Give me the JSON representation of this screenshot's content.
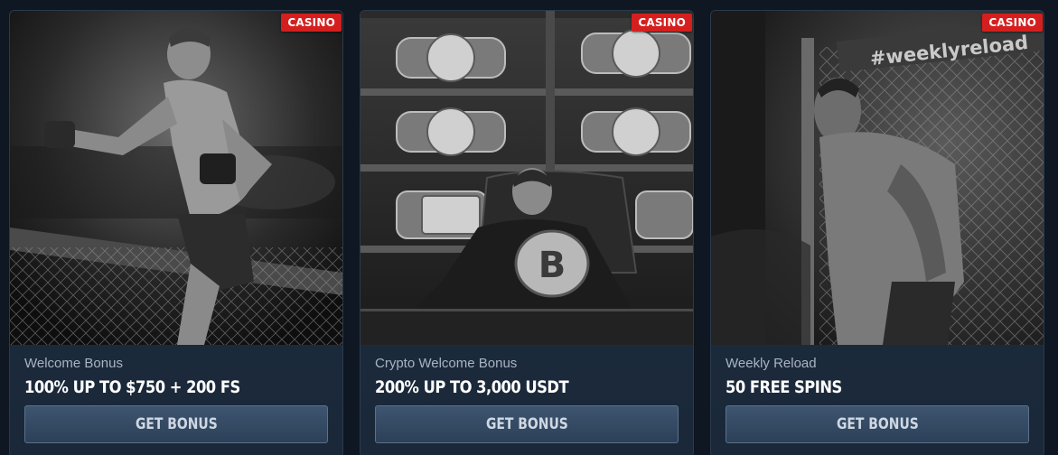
{
  "colors": {
    "page_bg": "#0e1722",
    "badge": "#d51f1f",
    "button": "#34495f",
    "offer_text": "#ffffff",
    "subtitle_text": "#a8b4c2"
  },
  "cards": [
    {
      "badge": "CASINO",
      "subtitle": "Welcome Bonus",
      "offer": "100% UP TO $750 + 200 FS",
      "button": "GET BONUS",
      "image_icon": "fighter-pointing-photo"
    },
    {
      "badge": "CASINO",
      "subtitle": "Crypto Welcome Bonus",
      "offer": "200% UP TO 3,000 USDT",
      "button": "GET BONUS",
      "image_icon": "champion-belts-office-photo"
    },
    {
      "badge": "CASINO",
      "subtitle": "Weekly Reload",
      "offer": "50 FREE SPINS",
      "button": "GET BONUS",
      "image_icon": "fighter-cage-photo",
      "cage_text": "#weeklyreload"
    }
  ]
}
